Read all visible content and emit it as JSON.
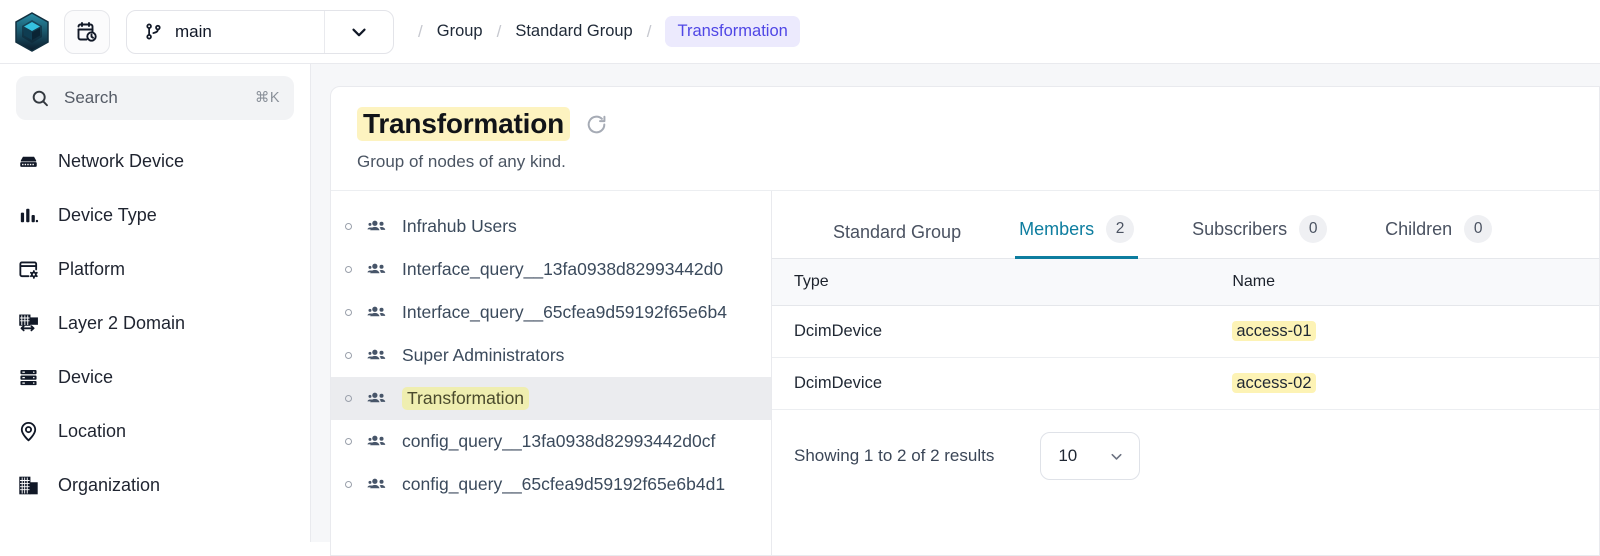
{
  "topbar": {
    "logo_icon": "infrahub-hex-cube-logo",
    "calendar_icon": "calendar-clock-icon",
    "branch": {
      "icon": "git-branch-icon",
      "value": "main",
      "caret_icon": "chevron-down-icon"
    },
    "breadcrumb": {
      "separator": "/",
      "items": [
        {
          "label": "Group",
          "active": false
        },
        {
          "label": "Standard Group",
          "active": false
        },
        {
          "label": "Transformation",
          "active": true
        }
      ],
      "active_color": "#4f46e5",
      "active_bg": "#eceafd"
    }
  },
  "sidebar": {
    "search": {
      "icon": "search-icon",
      "label": "Search",
      "shortcut": "⌘K"
    },
    "items": [
      {
        "label": "Network Device",
        "icon": "network-device-icon"
      },
      {
        "label": "Device Type",
        "icon": "bar-chart-icon"
      },
      {
        "label": "Platform",
        "icon": "platform-window-gear-icon"
      },
      {
        "label": "Layer 2 Domain",
        "icon": "layer2-domain-icon"
      },
      {
        "label": "Device",
        "icon": "server-stack-icon"
      },
      {
        "label": "Location",
        "icon": "location-pin-icon"
      },
      {
        "label": "Organization",
        "icon": "organization-building-icon"
      }
    ]
  },
  "main": {
    "title": "Transformation",
    "title_highlight_color": "#fdf3c0",
    "refresh_icon": "refresh-icon",
    "subtitle": "Group of nodes of any kind."
  },
  "grouplist": {
    "items": [
      {
        "label": "Infrahub Users",
        "selected": false
      },
      {
        "label": "Interface_query__13fa0938d82993442d0",
        "selected": false
      },
      {
        "label": "Interface_query__65cfea9d59192f65e6b4",
        "selected": false
      },
      {
        "label": "Super Administrators",
        "selected": false
      },
      {
        "label": "Transformation",
        "selected": true
      },
      {
        "label": "config_query__13fa0938d82993442d0cf",
        "selected": false
      },
      {
        "label": "config_query__65cfea9d59192f65e6b4d1",
        "selected": false
      }
    ],
    "item_icon": "group-people-icon",
    "selected_highlight_color": "#efeeb0"
  },
  "detail": {
    "tabs": [
      {
        "label": "Standard Group",
        "badge": null,
        "active": false
      },
      {
        "label": "Members",
        "badge": "2",
        "active": true
      },
      {
        "label": "Subscribers",
        "badge": "0",
        "active": false
      },
      {
        "label": "Children",
        "badge": "0",
        "active": false
      }
    ],
    "active_tab_color": "#0d7d9f",
    "table": {
      "columns": [
        "Type",
        "Name"
      ],
      "rows": [
        {
          "type": "DcimDevice",
          "name": "access-01"
        },
        {
          "type": "DcimDevice",
          "name": "access-02"
        }
      ],
      "name_highlight_color": "#fdf3b5"
    },
    "pagination": {
      "text": "Showing 1 to 2 of 2 results",
      "page_size": "10",
      "caret_icon": "chevron-down-icon"
    }
  }
}
